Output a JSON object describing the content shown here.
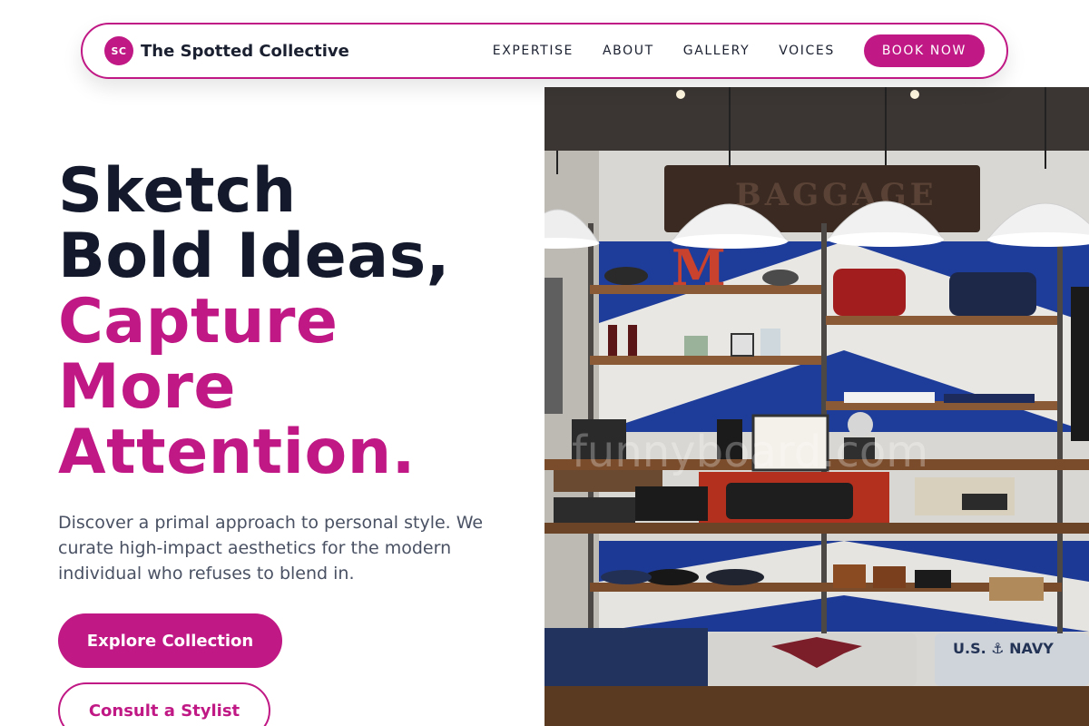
{
  "brand": {
    "initials": "SC",
    "name": "The Spotted Collective"
  },
  "nav": {
    "links": [
      "EXPERTISE",
      "ABOUT",
      "GALLERY",
      "VOICES"
    ],
    "cta": "BOOK NOW"
  },
  "hero": {
    "title_lines_dark": [
      "Sketch",
      "Bold Ideas,"
    ],
    "title_lines_accent": [
      "Capture",
      "More",
      "Attention."
    ],
    "description": "Discover a primal approach to personal style. We curate high-impact aesthetics for the modern individual who refuses to blend in.",
    "primary_cta": "Explore Collection",
    "secondary_cta": "Consult a Stylist"
  },
  "image": {
    "subject": "boutique clothing store interior with pendant lamps and wooden shelves",
    "sign_text": "BAGGAGE",
    "letter_text": "M",
    "shirt_text": "U.S. ⚓ NAVY",
    "watermark": "funnyboard.com"
  },
  "colors": {
    "accent": "#c01884",
    "heading": "#141a2b",
    "body": "#495163"
  }
}
